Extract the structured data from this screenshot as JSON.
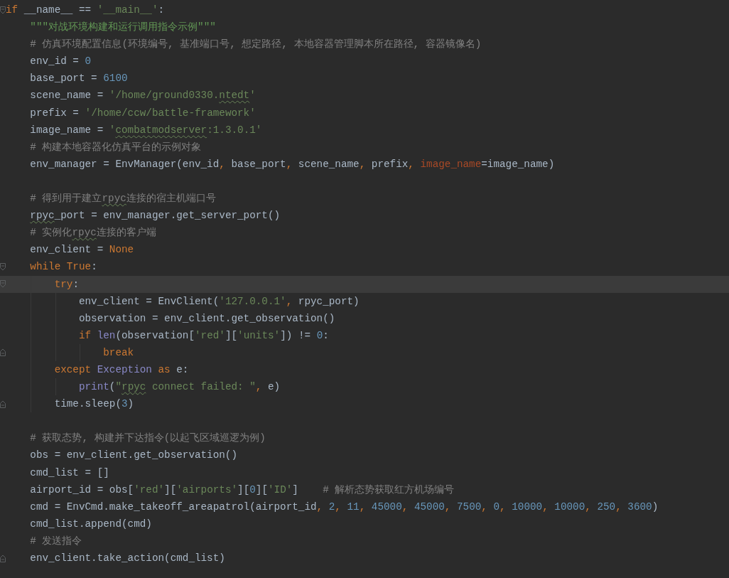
{
  "editor": {
    "lines": [
      {
        "kind": "fold_start",
        "current": false,
        "tokens": [
          {
            "kind": "keyword",
            "text": "if"
          },
          {
            "kind": "plain",
            "text": " __name__ == "
          },
          {
            "kind": "string",
            "text": "'__main__'"
          },
          {
            "kind": "plain",
            "text": ":"
          }
        ]
      },
      {
        "kind": "plain",
        "current": false,
        "tokens": [
          {
            "kind": "docstring",
            "text": "    \"\"\"对战环境构建和运行调用指令示例\"\"\""
          }
        ]
      },
      {
        "kind": "plain",
        "current": false,
        "tokens": [
          {
            "kind": "comment",
            "text": "    # 仿真环境配置信息(环境编号, 基准端口号, 想定路径, 本地容器管理脚本所在路径, 容器镜像名)"
          }
        ]
      },
      {
        "kind": "plain",
        "current": false,
        "tokens": [
          {
            "kind": "plain",
            "text": "    env_id = "
          },
          {
            "kind": "number",
            "text": "0"
          }
        ]
      },
      {
        "kind": "plain",
        "current": false,
        "tokens": [
          {
            "kind": "plain",
            "text": "    base_port = "
          },
          {
            "kind": "number",
            "text": "6100"
          }
        ]
      },
      {
        "kind": "plain",
        "current": false,
        "tokens": [
          {
            "kind": "plain",
            "text": "    scene_name = "
          },
          {
            "kind": "string",
            "text": "'/home/ground0330."
          },
          {
            "kind": "string",
            "text": "ntedt",
            "typo": true
          },
          {
            "kind": "string",
            "text": "'"
          }
        ]
      },
      {
        "kind": "plain",
        "current": false,
        "tokens": [
          {
            "kind": "plain",
            "text": "    prefix = "
          },
          {
            "kind": "string",
            "text": "'/home/ccw/battle-framework'"
          }
        ]
      },
      {
        "kind": "plain",
        "current": false,
        "tokens": [
          {
            "kind": "plain",
            "text": "    image_name = "
          },
          {
            "kind": "string",
            "text": "'"
          },
          {
            "kind": "string",
            "text": "combatmodserver",
            "typo": true
          },
          {
            "kind": "string",
            "text": ":1.3.0.1'"
          }
        ]
      },
      {
        "kind": "plain",
        "current": false,
        "tokens": [
          {
            "kind": "comment",
            "text": "    # 构建本地容器化仿真平台的示例对象"
          }
        ]
      },
      {
        "kind": "plain",
        "current": false,
        "tokens": [
          {
            "kind": "plain",
            "text": "    env_manager = EnvManager(env_id"
          },
          {
            "kind": "keyword",
            "text": ","
          },
          {
            "kind": "plain",
            "text": " base_port"
          },
          {
            "kind": "keyword",
            "text": ","
          },
          {
            "kind": "plain",
            "text": " scene_name"
          },
          {
            "kind": "keyword",
            "text": ","
          },
          {
            "kind": "plain",
            "text": " prefix"
          },
          {
            "kind": "keyword",
            "text": ","
          },
          {
            "kind": "param",
            "text": " image_name"
          },
          {
            "kind": "plain",
            "text": "=image_name)"
          }
        ]
      },
      {
        "kind": "plain",
        "current": false
      },
      {
        "kind": "plain",
        "current": false,
        "tokens": [
          {
            "kind": "comment",
            "text": "    # 得到用于建立"
          },
          {
            "kind": "comment",
            "text": "rpyc",
            "typo": true
          },
          {
            "kind": "comment",
            "text": "连接的宿主机端口号"
          }
        ]
      },
      {
        "kind": "plain",
        "current": false,
        "tokens": [
          {
            "kind": "plain",
            "text": "    rpyc",
            "typo": true
          },
          {
            "kind": "plain",
            "text": "_port = env_manager.get_server_port()"
          }
        ]
      },
      {
        "kind": "plain",
        "current": false,
        "tokens": [
          {
            "kind": "comment",
            "text": "    # 实例化"
          },
          {
            "kind": "comment",
            "text": "rpyc",
            "typo": true
          },
          {
            "kind": "comment",
            "text": "连接的客户端"
          }
        ]
      },
      {
        "kind": "plain",
        "current": false,
        "tokens": [
          {
            "kind": "plain",
            "text": "    env_client = "
          },
          {
            "kind": "keyword",
            "text": "None"
          }
        ]
      },
      {
        "kind": "fold_start",
        "current": false,
        "tokens": [
          {
            "kind": "keyword",
            "text": "    while True"
          },
          {
            "kind": "plain",
            "text": ":"
          }
        ]
      },
      {
        "kind": "fold_start",
        "current": true,
        "tokens": [
          {
            "kind": "keyword",
            "text": "        try"
          },
          {
            "kind": "plain",
            "text": ":"
          }
        ]
      },
      {
        "kind": "plain",
        "current": false,
        "tokens": [
          {
            "kind": "plain",
            "text": "            env_client = EnvClient("
          },
          {
            "kind": "string",
            "text": "'127.0.0.1'"
          },
          {
            "kind": "keyword",
            "text": ","
          },
          {
            "kind": "plain",
            "text": " rpyc_port)"
          }
        ]
      },
      {
        "kind": "plain",
        "current": false,
        "tokens": [
          {
            "kind": "plain",
            "text": "            observation = env_client.get_observation()"
          }
        ]
      },
      {
        "kind": "plain",
        "current": false,
        "tokens": [
          {
            "kind": "keyword",
            "text": "            if "
          },
          {
            "kind": "builtin",
            "text": "len"
          },
          {
            "kind": "plain",
            "text": "(observation["
          },
          {
            "kind": "string",
            "text": "'red'"
          },
          {
            "kind": "plain",
            "text": "]["
          },
          {
            "kind": "string",
            "text": "'units'"
          },
          {
            "kind": "plain",
            "text": "]) != "
          },
          {
            "kind": "number",
            "text": "0"
          },
          {
            "kind": "plain",
            "text": ":"
          }
        ]
      },
      {
        "kind": "fold_end",
        "current": false,
        "tokens": [
          {
            "kind": "keyword",
            "text": "                break"
          }
        ]
      },
      {
        "kind": "plain",
        "current": false,
        "tokens": [
          {
            "kind": "keyword",
            "text": "        except "
          },
          {
            "kind": "builtin",
            "text": "Exception"
          },
          {
            "kind": "keyword",
            "text": " as "
          },
          {
            "kind": "plain",
            "text": "e:"
          }
        ]
      },
      {
        "kind": "plain",
        "current": false,
        "tokens": [
          {
            "kind": "builtin",
            "text": "            print"
          },
          {
            "kind": "plain",
            "text": "("
          },
          {
            "kind": "string",
            "text": "\""
          },
          {
            "kind": "string",
            "text": "rpyc",
            "typo": true
          },
          {
            "kind": "string",
            "text": " connect failed: \""
          },
          {
            "kind": "keyword",
            "text": ","
          },
          {
            "kind": "plain",
            "text": " e)"
          }
        ]
      },
      {
        "kind": "fold_end",
        "current": false,
        "tokens": [
          {
            "kind": "plain",
            "text": "        time.sleep("
          },
          {
            "kind": "number",
            "text": "3"
          },
          {
            "kind": "plain",
            "text": ")"
          }
        ]
      },
      {
        "kind": "plain",
        "current": false
      },
      {
        "kind": "plain",
        "current": false,
        "tokens": [
          {
            "kind": "comment",
            "text": "    # 获取态势, 构建并下达指令(以起飞区域巡逻为例)"
          }
        ]
      },
      {
        "kind": "plain",
        "current": false,
        "tokens": [
          {
            "kind": "plain",
            "text": "    obs = env_client.get_observation()"
          }
        ]
      },
      {
        "kind": "plain",
        "current": false,
        "tokens": [
          {
            "kind": "plain",
            "text": "    cmd_list = []"
          }
        ]
      },
      {
        "kind": "plain",
        "current": false,
        "tokens": [
          {
            "kind": "plain",
            "text": "    airport_id = obs["
          },
          {
            "kind": "string",
            "text": "'red'"
          },
          {
            "kind": "plain",
            "text": "]["
          },
          {
            "kind": "string",
            "text": "'airports'"
          },
          {
            "kind": "plain",
            "text": "]["
          },
          {
            "kind": "number",
            "text": "0"
          },
          {
            "kind": "plain",
            "text": "]["
          },
          {
            "kind": "string",
            "text": "'ID'"
          },
          {
            "kind": "plain",
            "text": "]    "
          },
          {
            "kind": "comment",
            "text": "# 解析态势获取红方机场编号"
          }
        ]
      },
      {
        "kind": "plain",
        "current": false,
        "tokens": [
          {
            "kind": "plain",
            "text": "    cmd = EnvCmd.make_takeoff_areapatrol(airport_id"
          },
          {
            "kind": "keyword",
            "text": ","
          },
          {
            "kind": "number",
            "text": " 2"
          },
          {
            "kind": "keyword",
            "text": ","
          },
          {
            "kind": "number",
            "text": " 11"
          },
          {
            "kind": "keyword",
            "text": ","
          },
          {
            "kind": "number",
            "text": " 45000"
          },
          {
            "kind": "keyword",
            "text": ","
          },
          {
            "kind": "number",
            "text": " 45000"
          },
          {
            "kind": "keyword",
            "text": ","
          },
          {
            "kind": "number",
            "text": " 7500"
          },
          {
            "kind": "keyword",
            "text": ","
          },
          {
            "kind": "number",
            "text": " 0"
          },
          {
            "kind": "keyword",
            "text": ","
          },
          {
            "kind": "number",
            "text": " 10000"
          },
          {
            "kind": "keyword",
            "text": ","
          },
          {
            "kind": "number",
            "text": " 10000"
          },
          {
            "kind": "keyword",
            "text": ","
          },
          {
            "kind": "number",
            "text": " 250"
          },
          {
            "kind": "keyword",
            "text": ","
          },
          {
            "kind": "number",
            "text": " 3600"
          },
          {
            "kind": "plain",
            "text": ")"
          }
        ]
      },
      {
        "kind": "plain",
        "current": false,
        "tokens": [
          {
            "kind": "plain",
            "text": "    cmd_list.append(cmd)"
          }
        ]
      },
      {
        "kind": "plain",
        "current": false,
        "tokens": [
          {
            "kind": "comment",
            "text": "    # 发送指令"
          }
        ]
      },
      {
        "kind": "fold_end",
        "current": false,
        "tokens": [
          {
            "kind": "plain",
            "text": "    env_client.take_action(cmd_list)"
          }
        ]
      }
    ]
  }
}
